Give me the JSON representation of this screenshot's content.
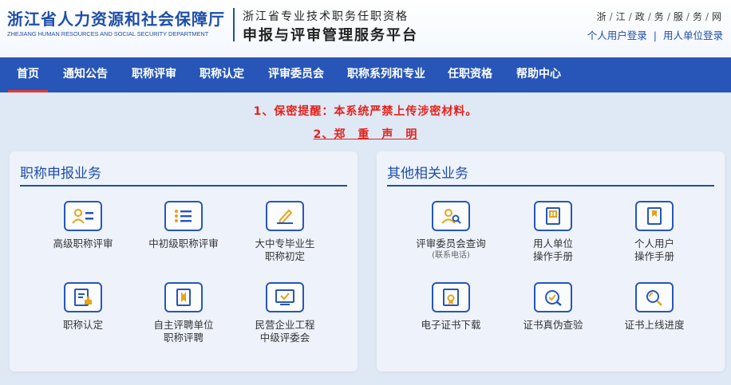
{
  "header": {
    "dept_name": "浙江省人力资源和社会保障厅",
    "dept_name_en": "ZHEJIANG HUMAN RESOURCES AND SOCIAL SECURITY DEPARTMENT",
    "platform_subtitle": "浙江省专业技术职务任职资格",
    "platform_title": "申报与评审管理服务平台",
    "portal_chars": [
      "浙",
      "江",
      "政",
      "务",
      "服",
      "务",
      "网"
    ],
    "personal_login": "个人用户登录",
    "login_sep": "|",
    "employer_login": "用人单位登录"
  },
  "nav": {
    "items": [
      {
        "label": "首页",
        "active": true
      },
      {
        "label": "通知公告"
      },
      {
        "label": "职称评审"
      },
      {
        "label": "职称认定"
      },
      {
        "label": "评审委员会"
      },
      {
        "label": "职称系列和专业"
      },
      {
        "label": "任职资格"
      },
      {
        "label": "帮助中心"
      }
    ]
  },
  "notices": {
    "notice1": "1、保密提醒：本系统严禁上传涉密材料。",
    "notice2": "2、郑　重　声　明"
  },
  "left_panel": {
    "title": "职称申报业务",
    "tiles": [
      {
        "line1": "高级职称评审",
        "line2": ""
      },
      {
        "line1": "中初级职称评审",
        "line2": ""
      },
      {
        "line1": "大中专毕业生",
        "line2": "职称初定"
      },
      {
        "line1": "职称认定",
        "line2": ""
      },
      {
        "line1": "自主评聘单位",
        "line2": "职称评聘"
      },
      {
        "line1": "民营企业工程",
        "line2": "中级评委会"
      }
    ]
  },
  "right_panel": {
    "title": "其他相关业务",
    "tiles": [
      {
        "line1": "评审委员会查询",
        "line2": "(联系电话)"
      },
      {
        "line1": "用人单位",
        "line2": "操作手册"
      },
      {
        "line1": "个人用户",
        "line2": "操作手册"
      },
      {
        "line1": "电子证书下载",
        "line2": ""
      },
      {
        "line1": "证书真伪查验",
        "line2": ""
      },
      {
        "line1": "证书上线进度",
        "line2": ""
      }
    ]
  },
  "colors": {
    "brand_blue": "#2856b8",
    "accent_red": "#e4221c",
    "icon_gold": "#e8a317"
  }
}
